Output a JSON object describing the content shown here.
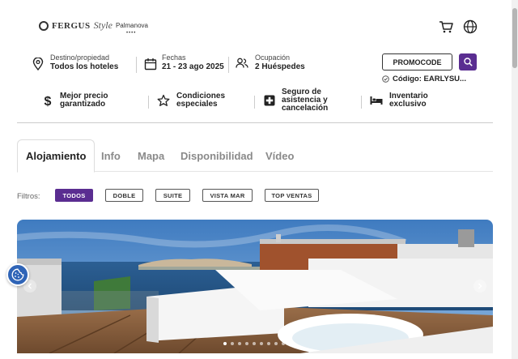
{
  "logo": {
    "brand": "FERGUS",
    "style": "Style",
    "place": "Palmanova",
    "stars": "••••"
  },
  "header": {
    "cart_icon": "cart-icon",
    "language_icon": "globe-icon"
  },
  "search": {
    "destination": {
      "label": "Destino/propiedad",
      "value": "Todos los hoteles"
    },
    "dates": {
      "label": "Fechas",
      "value": "21 - 23 ago 2025"
    },
    "occupancy": {
      "label": "Ocupación",
      "value": "2 Huéspedes"
    },
    "promo_button": "PROMOCODE",
    "code_text": "Código: EARLYSU..."
  },
  "benefits": [
    {
      "line1": "Mejor precio",
      "line2": "garantizado",
      "icon": "dollar-icon"
    },
    {
      "line1": "Condiciones",
      "line2": "especiales",
      "icon": "star-icon"
    },
    {
      "line1": "Seguro de",
      "line2": "asistencia y",
      "line3": "cancelación",
      "icon": "medical-cross-icon"
    },
    {
      "line1": "Inventario",
      "line2": "exclusivo",
      "icon": "bed-icon"
    }
  ],
  "tabs": [
    "Alojamiento",
    "Info",
    "Mapa",
    "Disponibilidad",
    "Vídeo"
  ],
  "active_tab": "Alojamiento",
  "filters": {
    "label": "Filtros:",
    "chips": [
      "TODOS",
      "DOBLE",
      "SUITE",
      "VISTA MAR",
      "TOP VENTAS"
    ],
    "active": "TODOS"
  },
  "gallery": {
    "slide_count": 9,
    "active_slide": 1
  },
  "colors": {
    "accent": "#5a2d91",
    "cookie": "#2f64b7",
    "sea": "#2f5f8f",
    "sky": "#5f97cf"
  }
}
